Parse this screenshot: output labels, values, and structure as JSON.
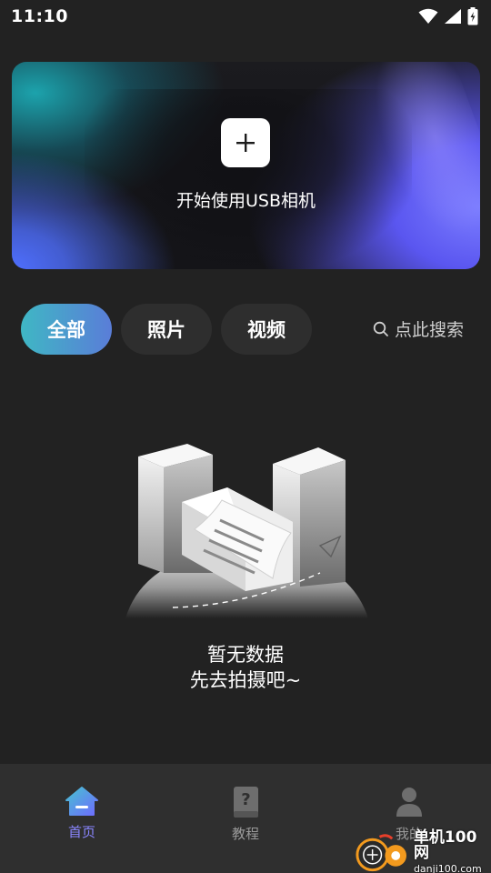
{
  "status_bar": {
    "time": "11:10",
    "icons": [
      "wifi-icon",
      "signal-icon",
      "battery-charging-icon"
    ]
  },
  "hero": {
    "action_icon": "plus-icon",
    "label": "开始使用USB相机"
  },
  "filters": {
    "tabs": [
      {
        "label": "全部",
        "active": true
      },
      {
        "label": "照片",
        "active": false
      },
      {
        "label": "视频",
        "active": false
      }
    ],
    "search": {
      "icon": "search-icon",
      "placeholder": "点此搜索"
    }
  },
  "empty_state": {
    "line1": "暂无数据",
    "line2": "先去拍摄吧~"
  },
  "bottom_nav": {
    "items": [
      {
        "label": "首页",
        "icon": "home-icon",
        "active": true
      },
      {
        "label": "教程",
        "icon": "help-book-icon",
        "active": false
      },
      {
        "label": "我的",
        "icon": "person-icon",
        "active": false
      }
    ]
  },
  "watermark": {
    "cn": "单机100网",
    "en": "danji100.com"
  },
  "colors": {
    "background": "#222222",
    "active_tab_gradient": [
      "#3fb7c4",
      "#5a7dd8"
    ],
    "nav_active": "#8a86ff",
    "nav_inactive": "#9a9a9a"
  }
}
